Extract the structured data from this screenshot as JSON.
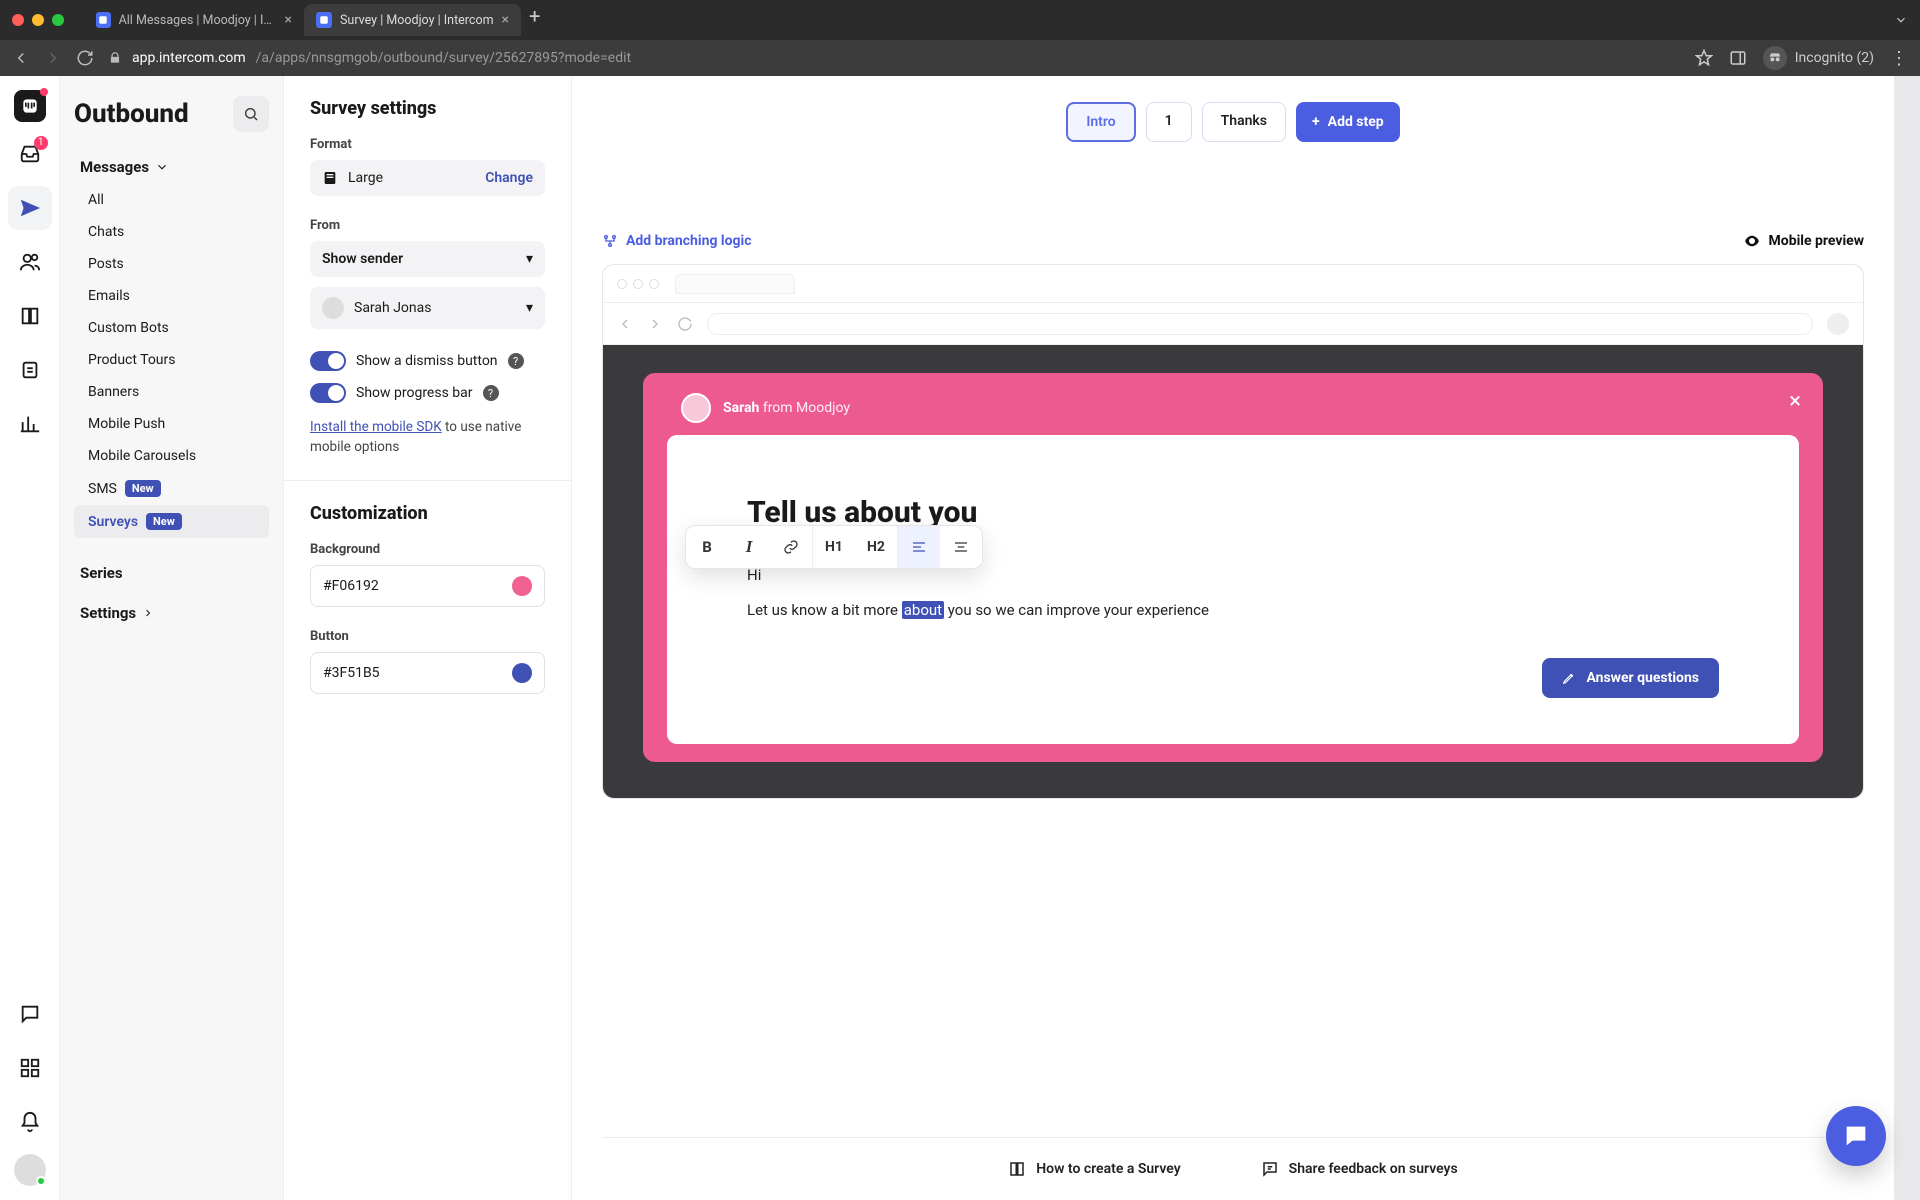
{
  "browser": {
    "tabs": [
      {
        "title": "All Messages | Moodjoy | Interc",
        "active": false
      },
      {
        "title": "Survey | Moodjoy | Intercom",
        "active": true
      }
    ],
    "url_host": "app.intercom.com",
    "url_path": "/a/apps/nnsgmgob/outbound/survey/25627895?mode=edit",
    "incognito_label": "Incognito (2)"
  },
  "rail": {
    "inbox_badge": "1"
  },
  "sidebar": {
    "title": "Outbound",
    "messages_label": "Messages",
    "items": [
      {
        "label": "All"
      },
      {
        "label": "Chats"
      },
      {
        "label": "Posts"
      },
      {
        "label": "Emails"
      },
      {
        "label": "Custom Bots"
      },
      {
        "label": "Product Tours"
      },
      {
        "label": "Banners"
      },
      {
        "label": "Mobile Push"
      },
      {
        "label": "Mobile Carousels"
      },
      {
        "label": "SMS",
        "new": true
      },
      {
        "label": "Surveys",
        "new": true,
        "active": true
      }
    ],
    "series_label": "Series",
    "settings_label": "Settings",
    "new_pill": "New"
  },
  "settings": {
    "heading": "Survey settings",
    "format_label": "Format",
    "format_value": "Large",
    "change_label": "Change",
    "from_label": "From",
    "from_mode": "Show sender",
    "from_person": "Sarah Jonas",
    "toggle_dismiss": "Show a dismiss button",
    "toggle_progress": "Show progress bar",
    "sdk_link": "Install the mobile SDK",
    "sdk_rest": " to use native mobile options",
    "customization_heading": "Customization",
    "bg_label": "Background",
    "bg_value": "#F06192",
    "btn_label": "Button",
    "btn_value": "#3F51B5"
  },
  "editor": {
    "steps": {
      "intro": "Intro",
      "one": "1",
      "thanks": "Thanks",
      "add": "Add step"
    },
    "branching_label": "Add branching logic",
    "mobile_preview_label": "Mobile preview",
    "survey": {
      "sender_name": "Sarah",
      "sender_from": " from Moodjoy",
      "title": "Tell us about you",
      "greeting": "Hi",
      "para_before": "Let us know a bit more ",
      "para_highlight": "about",
      "para_after": " you so we can improve your experience",
      "answer_btn": "Answer questions"
    },
    "toolbar": {
      "bold": "B",
      "italic": "I",
      "h1": "H1",
      "h2": "H2"
    }
  },
  "footer": {
    "howto": "How to create a Survey",
    "feedback": "Share feedback on surveys"
  }
}
